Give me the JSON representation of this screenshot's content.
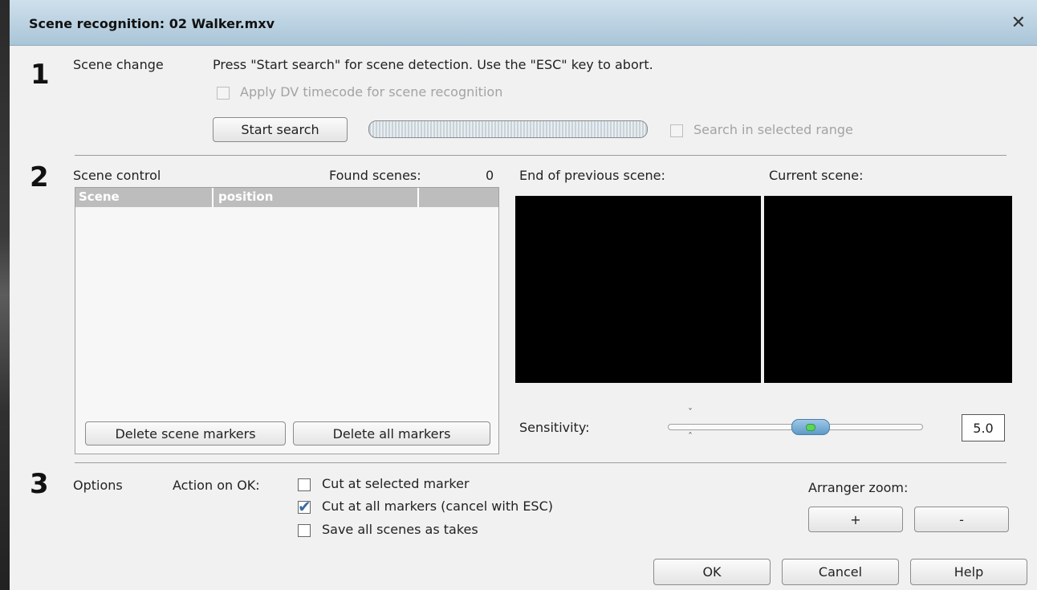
{
  "window": {
    "title": "Scene recognition: 02 Walker.mxv",
    "close_icon": "close-icon"
  },
  "section1": {
    "number": "1",
    "label": "Scene change",
    "instruction": "Press \"Start search\" for scene detection. Use the \"ESC\" key to abort.",
    "dv_timecode_label": "Apply DV timecode for scene recognition",
    "dv_timecode_checked": false,
    "start_search_label": "Start search",
    "progress": 0,
    "search_range_label": "Search in selected range",
    "search_range_checked": false
  },
  "section2": {
    "number": "2",
    "label": "Scene control",
    "found_scenes_label": "Found scenes:",
    "found_scenes_count": "0",
    "columns": [
      "Scene",
      "position"
    ],
    "rows": [],
    "end_prev_label": "End of previous scene:",
    "current_label": "Current scene:",
    "delete_scene_markers_label": "Delete scene markers",
    "delete_all_markers_label": "Delete all markers",
    "sensitivity_label": "Sensitivity:",
    "sensitivity_value": "5.0"
  },
  "section3": {
    "number": "3",
    "label": "Options",
    "action_label": "Action on OK:",
    "options": [
      {
        "label": "Cut at selected marker",
        "checked": false
      },
      {
        "label": "Cut at all markers (cancel with ESC)",
        "checked": true
      },
      {
        "label": "Save all scenes as takes",
        "checked": false
      }
    ],
    "arranger_zoom_label": "Arranger zoom:",
    "zoom_in_label": "+",
    "zoom_out_label": "-"
  },
  "footer": {
    "ok_label": "OK",
    "cancel_label": "Cancel",
    "help_label": "Help"
  },
  "colors": {
    "titlebar": "#a9c5d8",
    "accent_check": "#3c6aa0",
    "slider_thumb": "#5d9bc8"
  }
}
